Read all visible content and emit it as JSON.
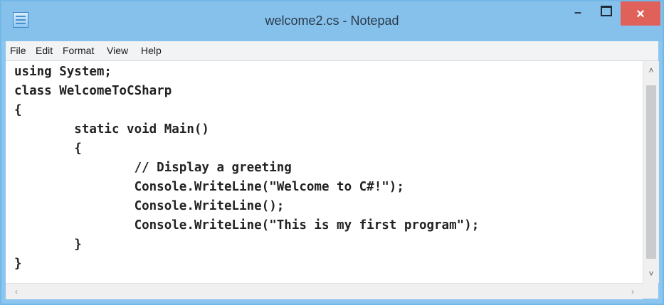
{
  "window": {
    "title": "welcome2.cs - Notepad"
  },
  "controls": {
    "minimize": "–",
    "close": "×"
  },
  "menu": [
    "File",
    "Edit",
    "Format",
    "View",
    "Help"
  ],
  "code": [
    "using System;",
    "class WelcomeToCSharp",
    "{",
    "        static void Main()",
    "        {",
    "                // Display a greeting",
    "                Console.WriteLine(\"Welcome to C#!\");",
    "                Console.WriteLine();",
    "                Console.WriteLine(\"This is my first program\");",
    "        }",
    "}"
  ],
  "scrollbar": {
    "up_arrow": "˄",
    "down_arrow": "˅",
    "left_arrow": "‹",
    "right_arrow": "›"
  }
}
